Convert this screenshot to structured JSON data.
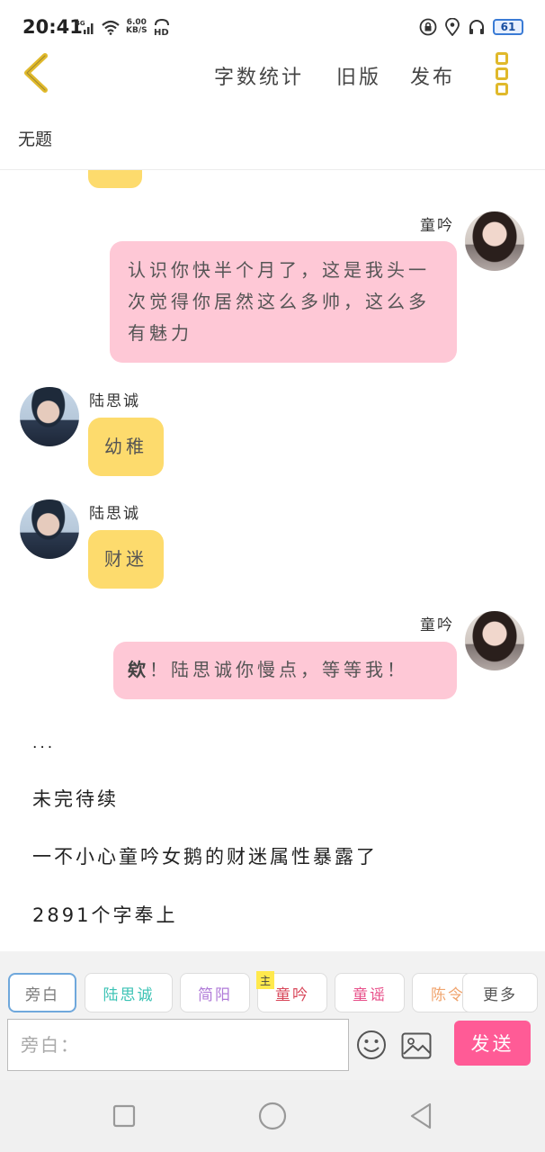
{
  "status_bar": {
    "time": "20:41",
    "network": "4G",
    "speed_value": "6.00",
    "speed_unit": "KB/S",
    "hd": "HD",
    "battery": "61"
  },
  "top_nav": {
    "word_count": "字数统计",
    "old_version": "旧版",
    "publish": "发布"
  },
  "doc_title": "无题",
  "messages": [
    {
      "speaker": "童吟",
      "text": "认识你快半个月了，这是我头一次觉得你居然这么多帅，这么多有魅力"
    },
    {
      "speaker": "陆思诚",
      "text": "幼稚"
    },
    {
      "speaker": "陆思诚",
      "text": "财迷"
    },
    {
      "speaker": "童吟",
      "text_first": "欸",
      "text_rest": "！陆思诚你慢点，等等我！"
    }
  ],
  "narration": [
    "...",
    "未完待续",
    "一不小心童吟女鹅的财迷属性暴露了",
    "2891个字奉上"
  ],
  "roles": [
    {
      "label": "旁白",
      "color": "#7a7a7a"
    },
    {
      "label": "陆思诚",
      "color": "#3cc3b5"
    },
    {
      "label": "简阳",
      "color": "#b07bd8"
    },
    {
      "label": "童吟",
      "color": "#d8475a"
    },
    {
      "label": "童谣",
      "color": "#e8508a"
    },
    {
      "label": "陈令",
      "color": "#f0a46e"
    },
    {
      "label": "更多",
      "color": "#555555"
    }
  ],
  "main_tag": "主",
  "input": {
    "placeholder": "旁白："
  },
  "send_label": "发送",
  "colors": {
    "pink_bubble": "#fec8d6",
    "yellow_bubble": "#fddb6d",
    "accent": "#e0b92b",
    "send": "#ff5b96"
  }
}
